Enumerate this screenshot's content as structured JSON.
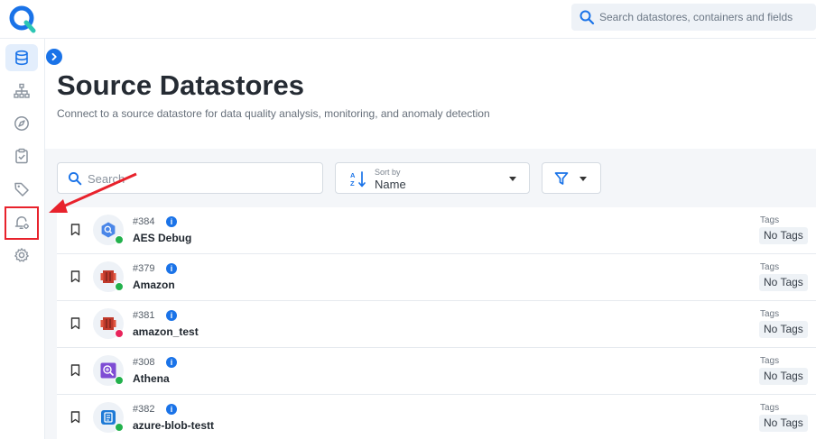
{
  "header": {
    "search_placeholder": "Search datastores, containers and fields"
  },
  "sidebar": {
    "items": [
      {
        "icon": "database-icon",
        "active": true
      },
      {
        "icon": "hierarchy-icon",
        "active": false
      },
      {
        "icon": "compass-icon",
        "active": false
      },
      {
        "icon": "clipboard-check-icon",
        "active": false
      },
      {
        "icon": "tag-icon",
        "active": false
      },
      {
        "icon": "bell-settings-icon",
        "active": false,
        "highlighted": true
      },
      {
        "icon": "gear-icon",
        "active": false
      }
    ]
  },
  "page": {
    "title": "Source Datastores",
    "subtitle": "Connect to a source datastore for data quality analysis, monitoring, and anomaly detection"
  },
  "toolbar": {
    "search_placeholder": "Search",
    "sort_label": "Sort by",
    "sort_value": "Name"
  },
  "datastores": [
    {
      "id": "#384",
      "name": "AES Debug",
      "icon": "bigquery-icon",
      "status": "green",
      "tags_label": "Tags",
      "tags_value": "No Tags"
    },
    {
      "id": "#379",
      "name": "Amazon",
      "icon": "redshift-icon",
      "status": "green",
      "tags_label": "Tags",
      "tags_value": "No Tags"
    },
    {
      "id": "#381",
      "name": "amazon_test",
      "icon": "redshift-icon",
      "status": "red",
      "tags_label": "Tags",
      "tags_value": "No Tags"
    },
    {
      "id": "#308",
      "name": "Athena",
      "icon": "athena-icon",
      "status": "green",
      "tags_label": "Tags",
      "tags_value": "No Tags"
    },
    {
      "id": "#382",
      "name": "azure-blob-testt",
      "icon": "azure-blob-icon",
      "status": "green",
      "tags_label": "Tags",
      "tags_value": "No Tags"
    }
  ],
  "colors": {
    "accent": "#1a73e8",
    "status_green": "#22b14c",
    "status_red": "#e8245b",
    "annotation_red": "#e8222c"
  }
}
